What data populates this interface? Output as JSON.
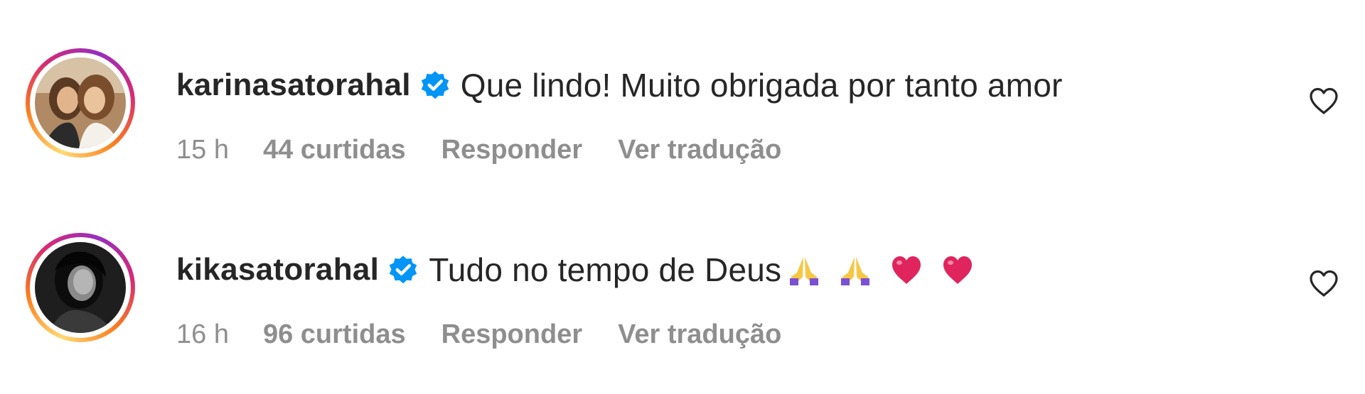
{
  "comments": [
    {
      "username": "karinasatorahal",
      "verified": true,
      "text": "Que lindo! Muito obrigada por tanto amor",
      "emojis": [],
      "time": "15 h",
      "likes": "44 curtidas",
      "reply_label": "Responder",
      "translate_label": "Ver tradução",
      "avatar_icon": "profile-photo-two-women"
    },
    {
      "username": "kikasatorahal",
      "verified": true,
      "text": "Tudo no tempo de Deus",
      "emojis": [
        "folded-hands",
        "folded-hands",
        "red-heart",
        "red-heart"
      ],
      "time": "16 h",
      "likes": "96 curtidas",
      "reply_label": "Responder",
      "translate_label": "Ver tradução",
      "avatar_icon": "profile-photo-woman-bw"
    }
  ],
  "colors": {
    "text": "#262626",
    "meta": "#8e8e8e",
    "verified": "#0095f6",
    "heart_emoji": "#e0245e",
    "hands_emoji": "#7b4fd6"
  },
  "icons": {
    "like": "heart-outline-icon",
    "verified": "verified-badge-icon"
  }
}
